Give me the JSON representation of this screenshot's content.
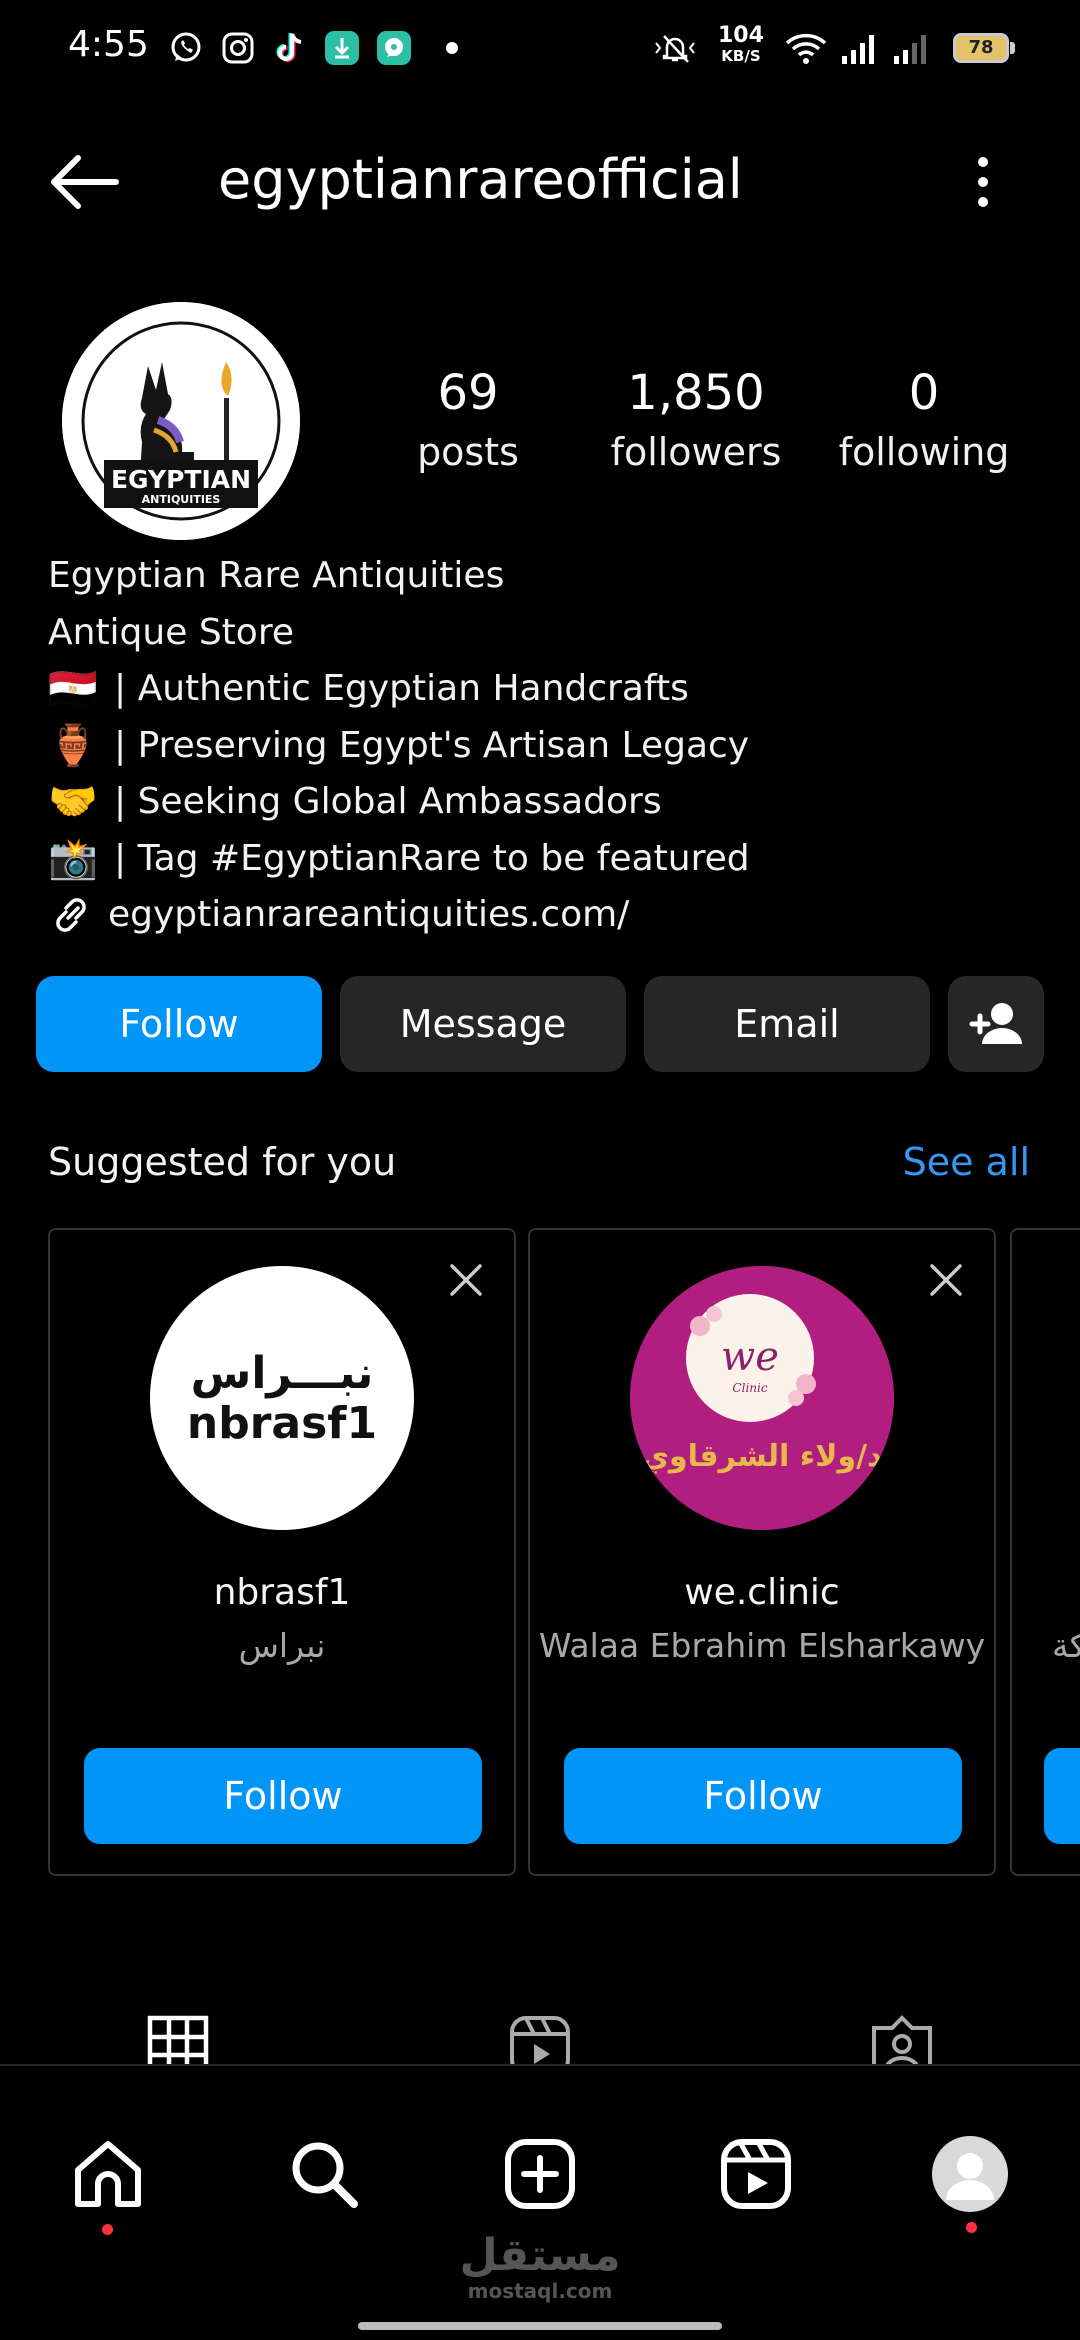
{
  "status_bar": {
    "time": "4:55",
    "net_speed_value": "104",
    "net_speed_unit": "KB/S",
    "battery": "78",
    "icons": [
      "whatsapp-icon",
      "instagram-icon",
      "tiktok-icon",
      "download-icon",
      "chat-app-icon",
      "notification-dot",
      "mute-icon",
      "wifi-icon",
      "signal-icon",
      "signal-icon-2",
      "battery-icon"
    ]
  },
  "header": {
    "username": "egyptianrareofficial"
  },
  "profile": {
    "avatar_text_main": "EGYPTIAN",
    "avatar_text_sub": "ANTIQUITIES",
    "stats": [
      {
        "value": "69",
        "label": "posts"
      },
      {
        "value": "1,850",
        "label": "followers"
      },
      {
        "value": "0",
        "label": "following"
      }
    ],
    "bio": {
      "name": "Egyptian Rare Antiquities",
      "category": "Antique Store",
      "lines": [
        {
          "emoji": "🇪🇬",
          "text": "| Authentic Egyptian Handcrafts"
        },
        {
          "emoji": "🏺",
          "text": "| Preserving Egypt's Artisan Legacy"
        },
        {
          "emoji": "🤝",
          "text": "| Seeking Global Ambassadors"
        },
        {
          "emoji": "📸",
          "text": "| Tag #EgyptianRare to be featured"
        }
      ],
      "link": "egyptianrareantiquities.com/"
    }
  },
  "actions": {
    "follow": "Follow",
    "message": "Message",
    "email": "Email"
  },
  "suggested": {
    "title": "Suggested for you",
    "see_all": "See all",
    "cards": [
      {
        "avatar_ar": "نبـــراس",
        "avatar_en": "nbrasf1",
        "username": "nbrasf1",
        "subtitle": "نبراس",
        "follow": "Follow"
      },
      {
        "avatar_logo": "we",
        "avatar_logo_sub": "Clinic",
        "avatar_ar": "د/ولاء الشرقاوي",
        "username": "we.clinic",
        "subtitle": "Walaa Ebrahim Elsharkawy",
        "follow": "Follow"
      }
    ],
    "peek_text": "كة"
  },
  "watermark": {
    "arabic": "مستقل",
    "latin": "mostaql.com"
  },
  "colors": {
    "background": "#000000",
    "primary_button": "#0095f6",
    "secondary_button": "#262626",
    "link_blue": "#3797f0",
    "notification_dot": "#ff3040",
    "clinic_pink": "#b01e7f"
  }
}
